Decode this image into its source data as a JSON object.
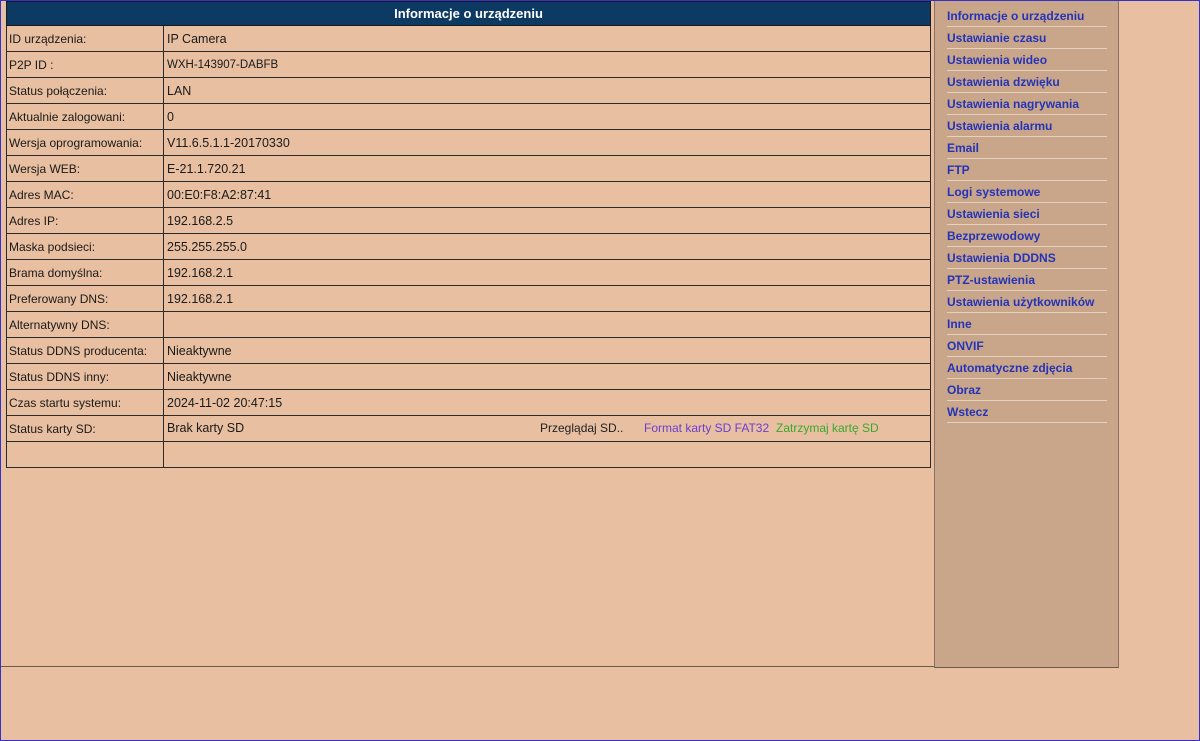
{
  "header": {
    "title": "Informacje o urządzeniu"
  },
  "rows": [
    {
      "label": "ID urządzenia:",
      "value": "IP Camera"
    },
    {
      "label": "P2P ID :",
      "value": "WXH-143907-DABFB"
    },
    {
      "label": "Status połączenia:",
      "value": "LAN"
    },
    {
      "label": "Aktualnie zalogowani:",
      "value": "0"
    },
    {
      "label": "Wersja oprogramowania:",
      "value": "V11.6.5.1.1-20170330"
    },
    {
      "label": "Wersja WEB:",
      "value": "E-21.1.720.21"
    },
    {
      "label": "Adres MAC:",
      "value": "00:E0:F8:A2:87:41"
    },
    {
      "label": "Adres IP:",
      "value": "192.168.2.5"
    },
    {
      "label": "Maska podsieci:",
      "value": "255.255.255.0"
    },
    {
      "label": "Brama domyślna:",
      "value": "192.168.2.1"
    },
    {
      "label": "Preferowany DNS:",
      "value": "192.168.2.1"
    },
    {
      "label": "Alternatywny DNS:",
      "value": ""
    },
    {
      "label": "Status DDNS producenta:",
      "value": "Nieaktywne"
    },
    {
      "label": "Status DDNS inny:",
      "value": "Nieaktywne"
    },
    {
      "label": "Czas startu systemu:",
      "value": "2024-11-02 20:47:15"
    }
  ],
  "sd": {
    "label": "Status karty SD:",
    "value": "Brak karty SD",
    "browse": "Przeglądaj SD..",
    "format": "Format karty SD FAT32",
    "stop": "Zatrzymaj kartę SD"
  },
  "sidebar": {
    "items": [
      {
        "label": "Informacje o urządzeniu"
      },
      {
        "label": "Ustawianie czasu"
      },
      {
        "label": "Ustawienia wideo"
      },
      {
        "label": "Ustawienia dzwięku"
      },
      {
        "label": "Ustawienia nagrywania"
      },
      {
        "label": "Ustawienia alarmu"
      },
      {
        "label": "Email"
      },
      {
        "label": "FTP"
      },
      {
        "label": "Logi systemowe"
      },
      {
        "label": "Ustawienia sieci"
      },
      {
        "label": "Bezprzewodowy"
      },
      {
        "label": "Ustawienia DDDNS"
      },
      {
        "label": "PTZ-ustawienia"
      },
      {
        "label": "Ustawienia użytkowników"
      },
      {
        "label": "Inne"
      },
      {
        "label": "ONVIF"
      },
      {
        "label": "Automatyczne zdjęcia"
      },
      {
        "label": "Obraz"
      },
      {
        "label": "Wstecz"
      }
    ]
  },
  "colors": {
    "background": "#e8bfa0",
    "sidebar": "#c9a689",
    "header": "#0d3a63",
    "link": "#2433b8",
    "format_link": "#6a3fd0",
    "stop_link": "#3aa830"
  }
}
